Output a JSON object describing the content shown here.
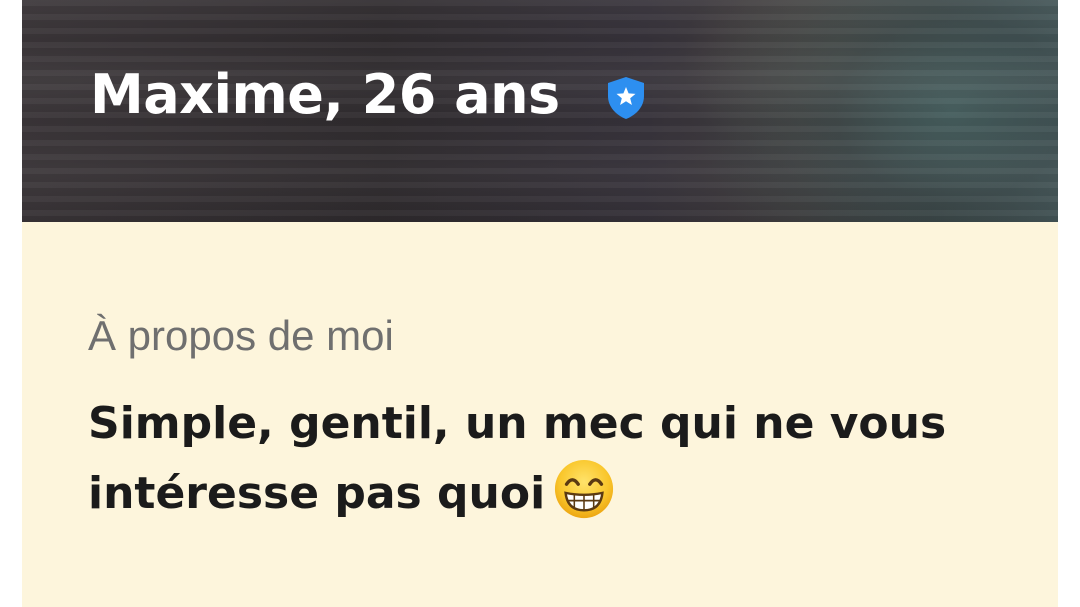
{
  "profile": {
    "name_age": "Maxime, 26 ans",
    "verified_icon": "verified-shield-star-icon",
    "badge_color": "#2d8ff0"
  },
  "about": {
    "heading": "À propos de moi",
    "text": "Simple, gentil, un mec qui ne vous intéresse pas quoi",
    "emoji_icon": "grinning-face-with-smiling-eyes-emoji"
  },
  "colors": {
    "about_background": "#fdf5dc",
    "heading_color": "#6f6f6f",
    "text_color": "#1b1b1b"
  }
}
